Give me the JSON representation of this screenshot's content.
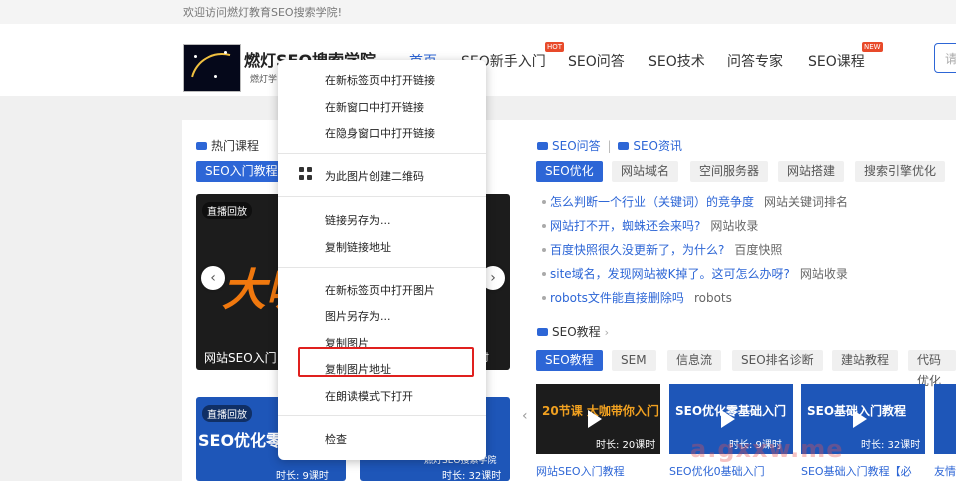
{
  "header": {
    "welcome": "欢迎访问燃灯教育SEO搜索学院!",
    "logo_title": "燃灯SEO搜索学院",
    "logo_sub": "燃灯学",
    "nav": [
      {
        "label": "首页",
        "badge": ""
      },
      {
        "label": "SEO新手入门",
        "badge": "HOT"
      },
      {
        "label": "SEO问答",
        "badge": ""
      },
      {
        "label": "SEO技术",
        "badge": ""
      },
      {
        "label": "问答专家",
        "badge": ""
      },
      {
        "label": "SEO课程",
        "badge": "NEW"
      }
    ],
    "search_placeholder": "请"
  },
  "hot_courses": {
    "title": "热门课程",
    "active_tab": "SEO入门教程",
    "cards": [
      {
        "live": "直播回放",
        "caption": "网站SEO入门",
        "big": "大咖",
        "duration": "时"
      },
      {
        "live": "直播回放",
        "caption": "SEO优化零",
        "duration": "时长: 9课时"
      },
      {
        "live": "",
        "caption": "燃灯SEO搜索学院",
        "duration": "时长: 32课时"
      }
    ],
    "prev": "‹",
    "next": "›"
  },
  "qa": {
    "title_a": "SEO问答",
    "title_sep": "|",
    "title_b": "SEO资讯",
    "tabs": [
      "SEO优化",
      "网站域名",
      "空间服务器",
      "网站搭建",
      "搜索引擎优化"
    ],
    "items": [
      {
        "text": "怎么判断一个行业（关键词）的竞争度",
        "tag": "网站关键词排名"
      },
      {
        "text": "网站打不开，蜘蛛还会来吗?",
        "tag": "网站收录"
      },
      {
        "text": "百度快照很久没更新了，为什么?",
        "tag": "百度快照"
      },
      {
        "text": "site域名，发现网站被K掉了。这可怎么办呀?",
        "tag": "网站收录"
      },
      {
        "text": "robots文件能直接删除吗",
        "tag": "robots"
      }
    ]
  },
  "tutorials": {
    "title": "SEO教程",
    "chevron": "›",
    "tabs": [
      "SEO教程",
      "SEM",
      "信息流",
      "SEO排名诊断",
      "建站教程",
      "代码优化"
    ],
    "thumbs": [
      {
        "title": "20节课 大咖带你入门",
        "duration": "时长: 20课时",
        "caption": "网站SEO入门教程"
      },
      {
        "title": "SEO优化零基础入门",
        "duration": "时长: 9课时",
        "caption": "SEO优化0基础入门"
      },
      {
        "title": "SEO基础入门教程",
        "duration": "时长: 32课时",
        "caption": "SEO基础入门教程【必"
      },
      {
        "title": "",
        "duration": "",
        "caption": "友情"
      }
    ],
    "prev": "‹"
  },
  "context_menu": {
    "items": [
      "在新标签页中打开链接",
      "在新窗口中打开链接",
      "在隐身窗口中打开链接",
      "为此图片创建二维码",
      "链接另存为...",
      "复制链接地址",
      "在新标签页中打开图片",
      "图片另存为...",
      "复制图片",
      "复制图片地址",
      "在朗读模式下打开",
      "检查"
    ]
  },
  "watermark": "a.gxxw.me",
  "colors": {
    "accent": "#2d66d6",
    "highlight": "#e0201e",
    "hot": "#e84a2a"
  }
}
